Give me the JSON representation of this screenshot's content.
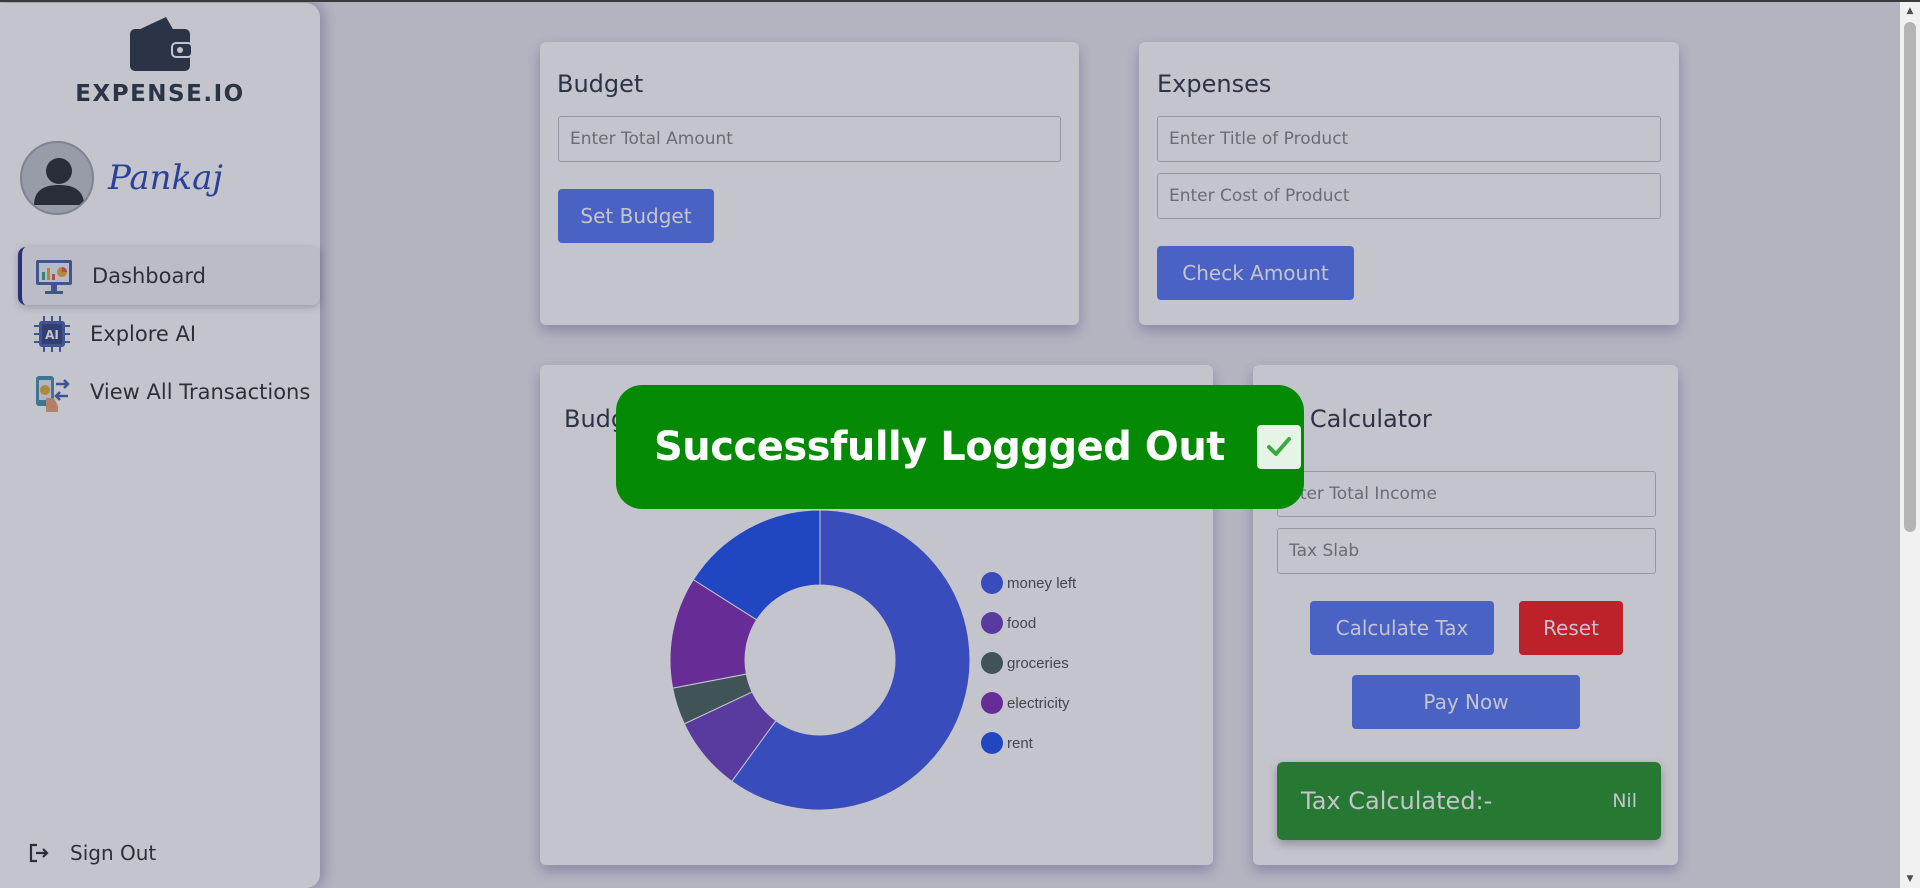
{
  "app": {
    "logo_text": "EXPENSE.IO",
    "username": "Pankaj"
  },
  "sidebar": {
    "items": [
      {
        "label": "Dashboard",
        "icon": "dashboard-monitor-icon",
        "active": true
      },
      {
        "label": "Explore AI",
        "icon": "ai-chip-icon",
        "active": false
      },
      {
        "label": "View All Transactions",
        "icon": "transactions-icon",
        "active": false
      }
    ],
    "signout_label": "Sign Out"
  },
  "budget": {
    "title": "Budget",
    "amount_placeholder": "Enter Total Amount",
    "button_label": "Set Budget"
  },
  "expenses": {
    "title": "Expenses",
    "title_placeholder": "Enter Title of Product",
    "cost_placeholder": "Enter Cost of Product",
    "button_label": "Check Amount"
  },
  "budget_chart": {
    "title": "Budg"
  },
  "tax": {
    "title": "x Calculator",
    "income_placeholder": "nter Total Income",
    "slab_placeholder": "Tax Slab",
    "calculate_label": "Calculate Tax",
    "reset_label": "Reset",
    "pay_label": "Pay Now",
    "result_label": "Tax Calculated:-",
    "result_value": "Nil"
  },
  "toast": {
    "message": "Successfully Loggged Out"
  },
  "colors": {
    "primary_button": "#4a6ff3",
    "reset_button": "#f50f0f",
    "toast_bg": "#048a04",
    "tax_result_bg": "#198f1c"
  },
  "chart_data": {
    "type": "pie",
    "donut": true,
    "categories": [
      "money left",
      "food",
      "groceries",
      "electricity",
      "rent"
    ],
    "values": [
      60,
      8,
      4,
      12,
      16
    ],
    "colors": [
      "#3150e6",
      "#6236bf",
      "#3d5a55",
      "#761fb0",
      "#0f46f0"
    ],
    "legend": "right"
  }
}
